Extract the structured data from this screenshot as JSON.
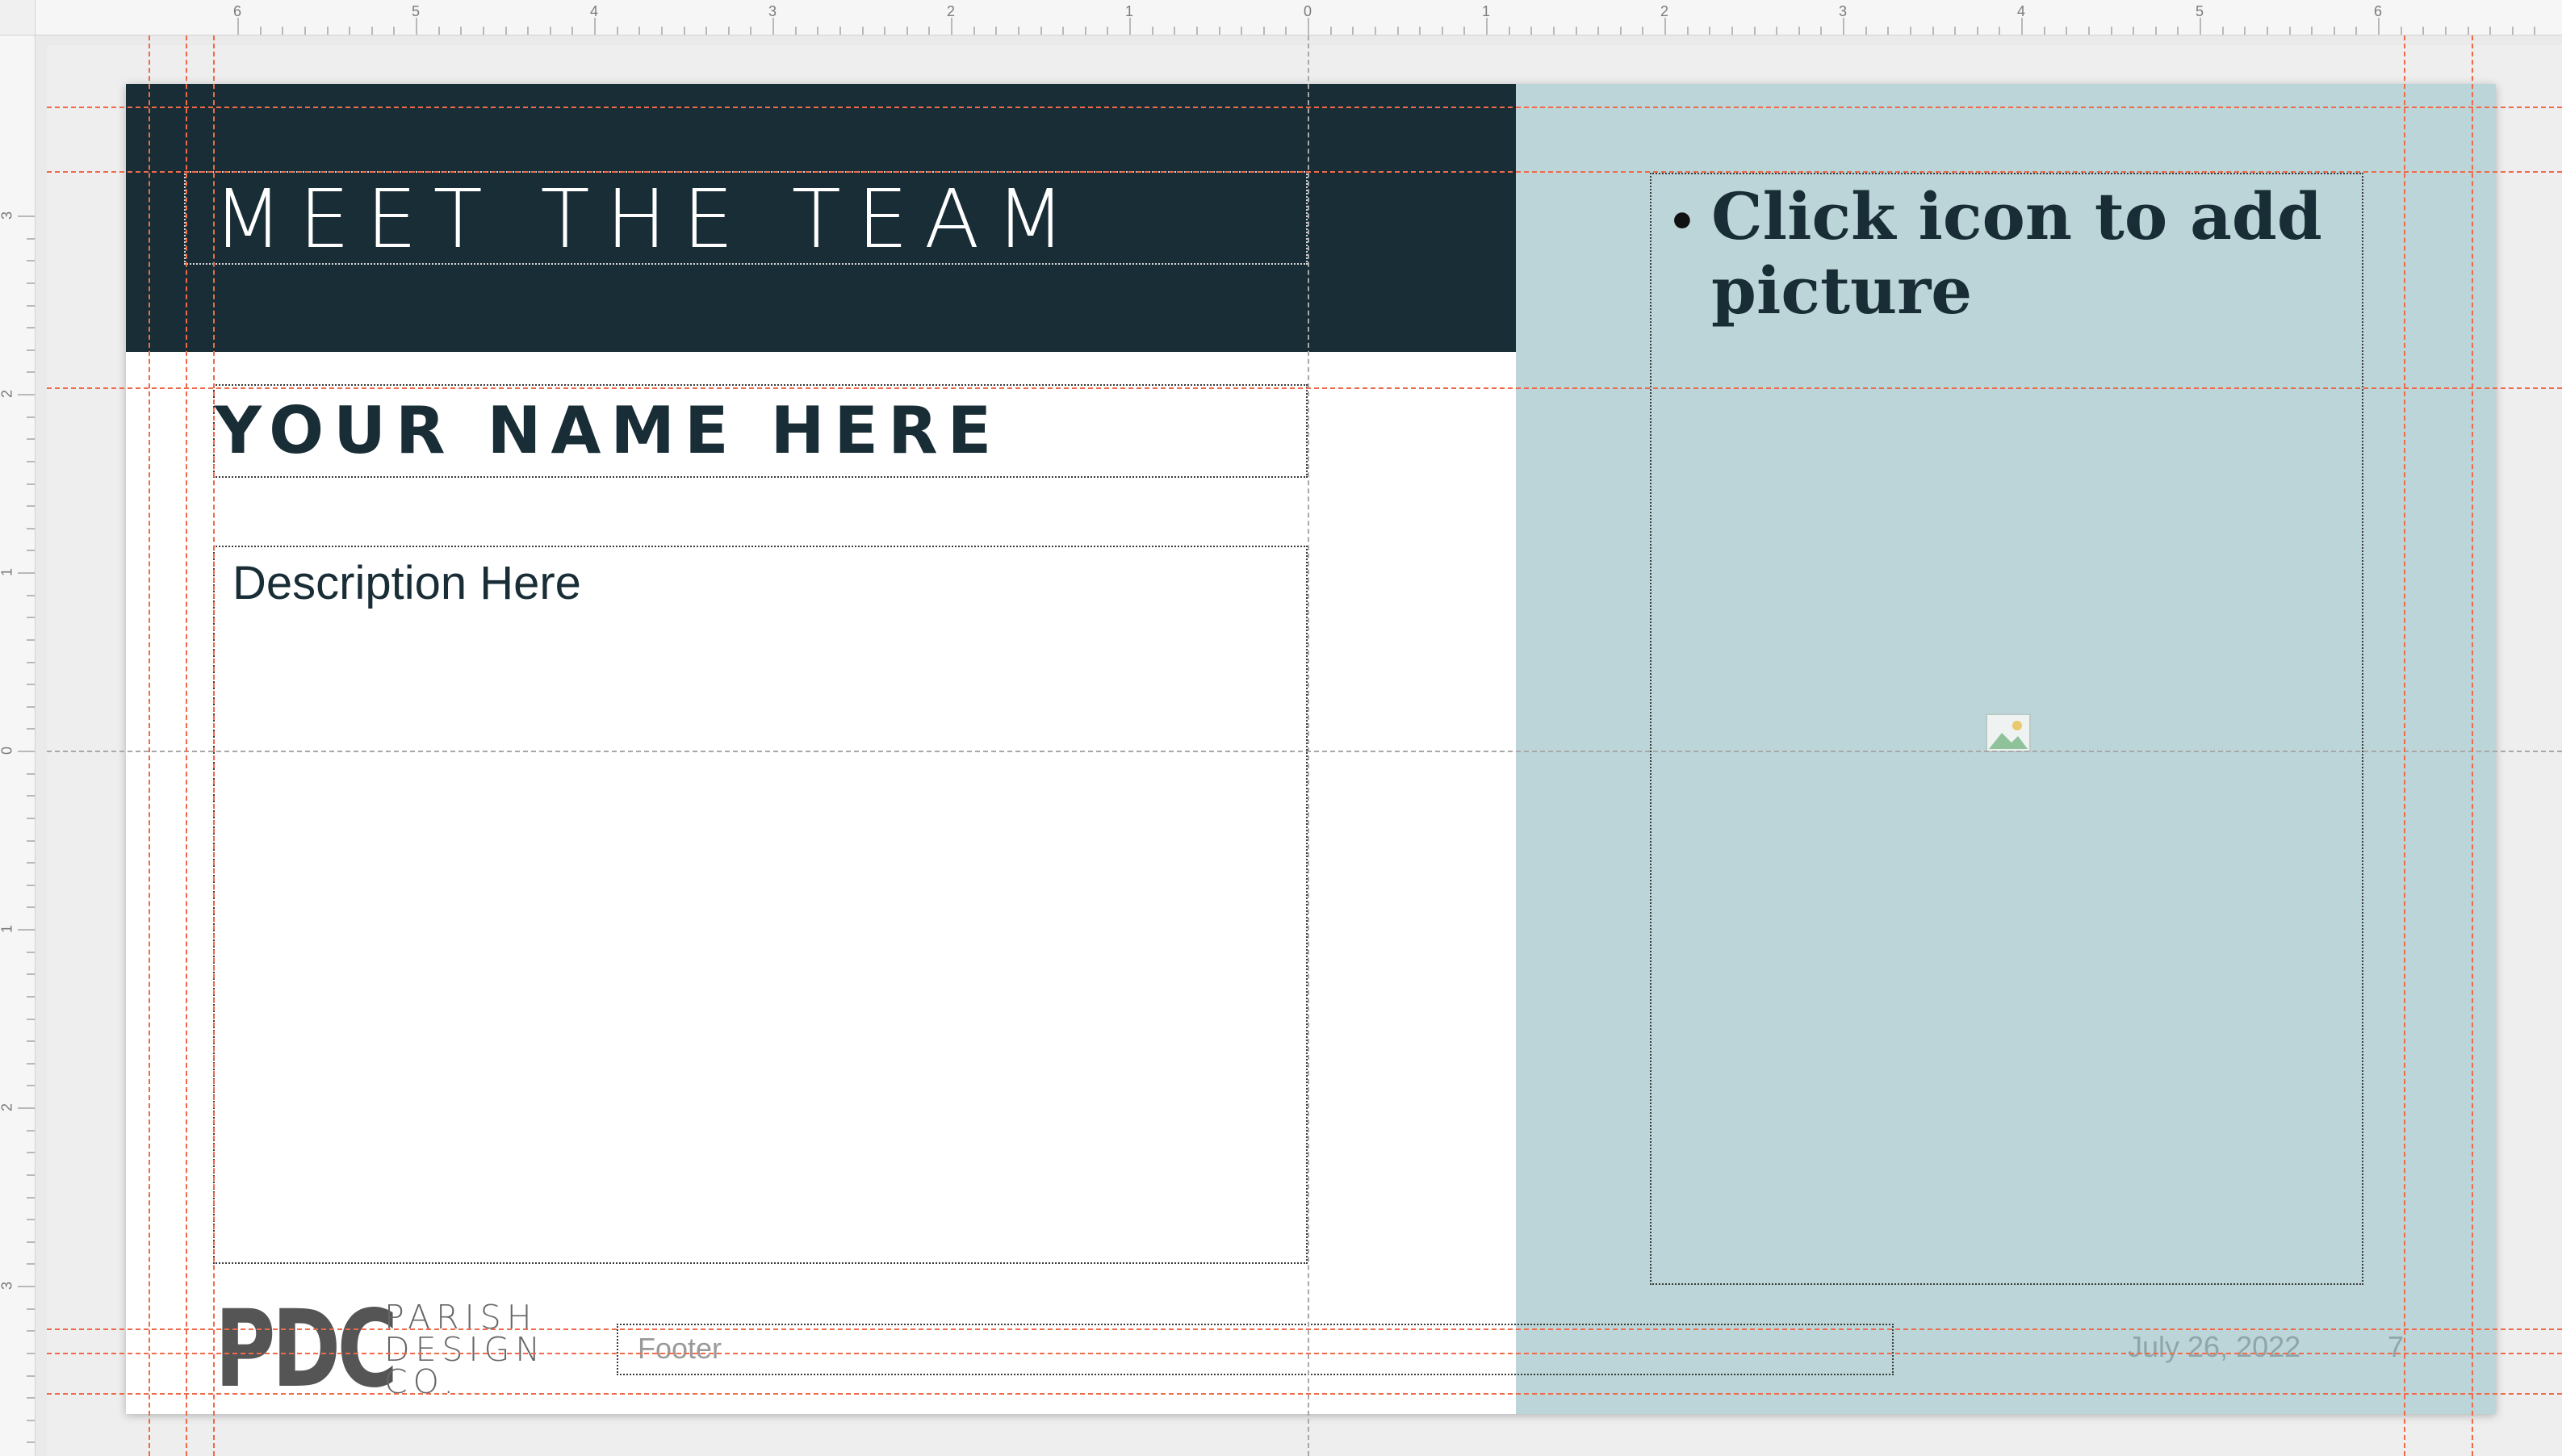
{
  "ruler": {
    "horizontal_labels": [
      "6",
      "5",
      "4",
      "3",
      "2",
      "1",
      "0",
      "1",
      "2",
      "3",
      "4",
      "5",
      "6"
    ],
    "vertical_labels": [
      "3",
      "2",
      "1",
      "0",
      "1",
      "2",
      "3"
    ]
  },
  "slide": {
    "title": "MEET THE TEAM",
    "name": "YOUR NAME HERE",
    "description": "Description Here",
    "picture_placeholder": {
      "bullet": "•",
      "text": "Click icon to add picture",
      "icon": "picture-icon"
    },
    "footer": "Footer",
    "date": "July 26, 2022",
    "page_number": "7",
    "logo": {
      "mark": "PDC",
      "line1": "PARISH",
      "line2": "DESIGN",
      "line3": "CO."
    }
  },
  "colors": {
    "header_band": "#182d35",
    "right_panel": "#bcd5d8",
    "guide": "#ee6a4a"
  }
}
